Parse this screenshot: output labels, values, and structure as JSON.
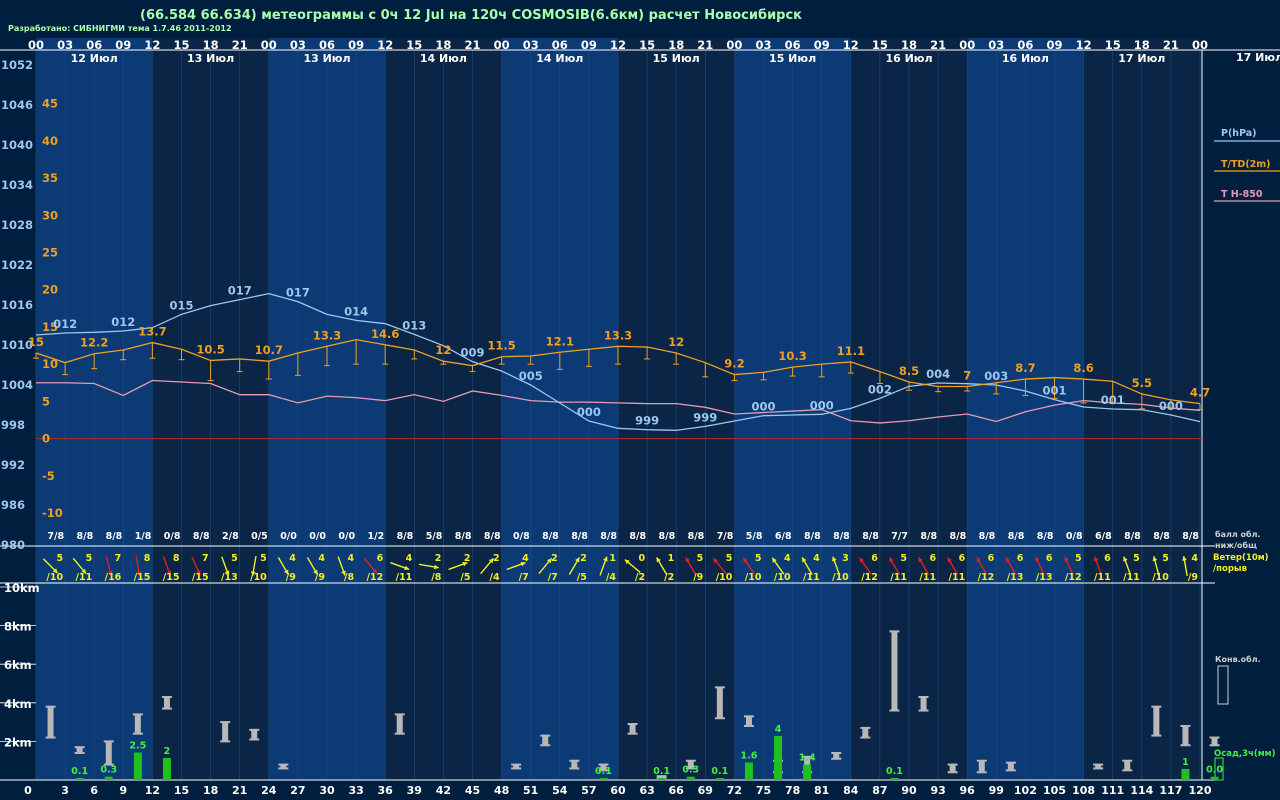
{
  "header": {
    "title": "(66.584 66.634) метеограммы с  0ч 12 Jul на 120ч COSMOSIB(6.6км) расчет Новосибирск",
    "credit": "Разработано: СИБНИГМИ тема 1.7.46 2011-2012"
  },
  "colors": {
    "background": "#001f3f",
    "band_light": "#0c3a74",
    "band_dark": "#0a2546",
    "pressure": "#9cc8f0",
    "temperature": "#f0a020",
    "t850": "#e89ab4",
    "zero_line": "#a03030",
    "wind_yellow": "#f0f020",
    "wind_red": "#e02020",
    "cloud": "#b8b8b8",
    "precip": "#20c020",
    "precip_label": "#40f040",
    "text": "#ffffff",
    "title": "#a8ffa8"
  },
  "chart_data": {
    "type": "line",
    "x_hours": [
      0,
      3,
      6,
      9,
      12,
      15,
      18,
      21,
      24,
      27,
      30,
      33,
      36,
      39,
      42,
      45,
      48,
      51,
      54,
      57,
      60,
      63,
      66,
      69,
      72,
      75,
      78,
      81,
      84,
      87,
      90,
      93,
      96,
      99,
      102,
      105,
      108,
      111,
      114,
      117,
      120
    ],
    "top_hour_labels": [
      "00",
      "03",
      "06",
      "09",
      "12",
      "15",
      "18",
      "21",
      "00",
      "03",
      "06",
      "09",
      "12",
      "15",
      "18",
      "21",
      "00",
      "03",
      "06",
      "09",
      "12",
      "15",
      "18",
      "21",
      "00",
      "03",
      "06",
      "09",
      "12",
      "15",
      "18",
      "21",
      "00",
      "03",
      "06",
      "09",
      "12",
      "15",
      "18",
      "21",
      "00"
    ],
    "date_labels": [
      "12 Июл",
      "13 Июл",
      "13 Июл",
      "14 Июл",
      "14 Июл",
      "15 Июл",
      "15 Июл",
      "16 Июл",
      "16 Июл",
      "17 Июл"
    ],
    "right_date_label": "17 Июл",
    "bottom_hour_labels": [
      "0",
      "3",
      "6",
      "9",
      "12",
      "15",
      "18",
      "21",
      "24",
      "27",
      "30",
      "33",
      "36",
      "39",
      "42",
      "45",
      "48",
      "51",
      "54",
      "57",
      "60",
      "63",
      "66",
      "69",
      "72",
      "75",
      "78",
      "81",
      "84",
      "87",
      "90",
      "93",
      "96",
      "99",
      "102",
      "105",
      "108",
      "111",
      "114",
      "117",
      "120"
    ],
    "pressure_axis": {
      "ticks": [
        "1052",
        "1046",
        "1040",
        "1034",
        "1028",
        "1022",
        "1016",
        "1010",
        "1004",
        "998",
        "992",
        "986",
        "980"
      ],
      "ylim": [
        980,
        1052
      ]
    },
    "temperature_axis": {
      "ticks": [
        "45",
        "40",
        "35",
        "30",
        "25",
        "20",
        "15",
        "10",
        "5",
        "0",
        "-5",
        "-10"
      ],
      "ylim": [
        -14.3,
        50.2
      ]
    },
    "legend": {
      "pressure": "P(hPa)",
      "temperature": "T/TD(2m)",
      "t850": "T H-850",
      "clouds": "балл обл.\nниж/общ",
      "wind": "Ветер(10м)\n/порыв",
      "convective": "Конв.обл.",
      "precip": "Осад,3ч(мм)"
    },
    "series": [
      {
        "name": "P(hPa)",
        "values": [
          1011.5,
          1011.8,
          1011.9,
          1012.1,
          1012.6,
          1014.6,
          1015.9,
          1016.8,
          1017.7,
          1016.5,
          1014.6,
          1013.7,
          1013.2,
          1011.6,
          1009.9,
          1007.5,
          1006.1,
          1004.0,
          1001.3,
          998.6,
          997.5,
          997.3,
          997.2,
          997.8,
          998.6,
          999.4,
          999.5,
          999.6,
          1000.5,
          1002.0,
          1003.8,
          1004.3,
          1004.2,
          1004.0,
          1003.1,
          1001.8,
          1000.7,
          1000.4,
          1000.3,
          999.5,
          998.5
        ]
      },
      {
        "name": "T/TD(2m)",
        "values": [
          11.5,
          10.2,
          11.4,
          11.9,
          12.9,
          12.0,
          10.5,
          10.7,
          10.4,
          11.5,
          12.4,
          13.3,
          12.6,
          11.9,
          10.4,
          9.8,
          11.0,
          11.1,
          11.6,
          12.0,
          12.4,
          12.3,
          11.5,
          10.2,
          8.6,
          8.9,
          9.6,
          10.0,
          10.3,
          9.0,
          7.6,
          7.0,
          7.0,
          7.5,
          8.0,
          8.2,
          8.0,
          7.7,
          6.0,
          5.2,
          4.7
        ]
      },
      {
        "name": "TD(2m)",
        "values": [
          10.8,
          8.6,
          9.4,
          10.6,
          10.8,
          10.6,
          7.8,
          9.0,
          8.0,
          8.5,
          9.8,
          10.0,
          10.0,
          10.7,
          10.0,
          9.0,
          10.0,
          10.0,
          9.3,
          9.7,
          10.0,
          10.7,
          10.0,
          8.3,
          7.8,
          7.9,
          8.4,
          8.3,
          8.8,
          7.4,
          6.5,
          6.3,
          6.4,
          6.0,
          5.8,
          5.4,
          4.8,
          4.7,
          4.0,
          4.0,
          3.9
        ]
      },
      {
        "name": "T H-850",
        "values": [
          7.5,
          7.5,
          7.4,
          5.8,
          7.8,
          7.6,
          7.4,
          5.9,
          5.9,
          4.8,
          5.7,
          5.5,
          5.1,
          5.9,
          5.0,
          6.4,
          5.8,
          5.1,
          4.9,
          4.9,
          4.8,
          4.7,
          4.7,
          4.2,
          3.3,
          3.5,
          3.7,
          3.9,
          2.4,
          2.1,
          2.4,
          2.9,
          3.3,
          2.3,
          3.6,
          4.5,
          5.1,
          4.8,
          4.6,
          4.1,
          3.8
        ]
      }
    ],
    "pressure_labels": [
      {
        "x": 3,
        "text": "012"
      },
      {
        "x": 9,
        "text": "012"
      },
      {
        "x": 15,
        "text": "015"
      },
      {
        "x": 21,
        "text": "017"
      },
      {
        "x": 27,
        "text": "017"
      },
      {
        "x": 33,
        "text": "014"
      },
      {
        "x": 39,
        "text": "013"
      },
      {
        "x": 45,
        "text": "009"
      },
      {
        "x": 51,
        "text": "005"
      },
      {
        "x": 57,
        "text": "000"
      },
      {
        "x": 63,
        "text": "999"
      },
      {
        "x": 69,
        "text": "999"
      },
      {
        "x": 75,
        "text": "000"
      },
      {
        "x": 81,
        "text": "000"
      },
      {
        "x": 87,
        "text": "002"
      },
      {
        "x": 93,
        "text": "004"
      },
      {
        "x": 99,
        "text": "003"
      },
      {
        "x": 105,
        "text": "001"
      },
      {
        "x": 111,
        "text": "001"
      },
      {
        "x": 117,
        "text": "000"
      }
    ],
    "temperature_labels": [
      {
        "x": 0,
        "text": "15"
      },
      {
        "x": 6,
        "text": "12.2"
      },
      {
        "x": 12,
        "text": "13.7"
      },
      {
        "x": 18,
        "text": "10.5"
      },
      {
        "x": 24,
        "text": "10.7"
      },
      {
        "x": 30,
        "text": "13.3"
      },
      {
        "x": 36,
        "text": "14.6"
      },
      {
        "x": 42,
        "text": "12"
      },
      {
        "x": 48,
        "text": "11.5"
      },
      {
        "x": 54,
        "text": "12.1"
      },
      {
        "x": 60,
        "text": "13.3"
      },
      {
        "x": 66,
        "text": "12"
      },
      {
        "x": 72,
        "text": "9.2"
      },
      {
        "x": 78,
        "text": "10.3"
      },
      {
        "x": 84,
        "text": "11.1"
      },
      {
        "x": 90,
        "text": "8.5"
      },
      {
        "x": 96,
        "text": "7"
      },
      {
        "x": 102,
        "text": "8.7"
      },
      {
        "x": 108,
        "text": "8.6"
      },
      {
        "x": 114,
        "text": "5.5"
      },
      {
        "x": 120,
        "text": "4.7"
      }
    ],
    "cloud_cover": [
      "7/8",
      "8/8",
      "8/8",
      "1/8",
      "0/8",
      "8/8",
      "2/8",
      "0/5",
      "0/0",
      "0/0",
      "0/0",
      "1/2",
      "8/8",
      "5/8",
      "8/8",
      "8/8",
      "0/8",
      "8/8",
      "8/8",
      "8/8",
      "8/8",
      "8/8",
      "8/8",
      "7/8",
      "5/8",
      "6/8",
      "8/8",
      "8/8",
      "8/8",
      "7/7",
      "8/8",
      "8/8",
      "8/8",
      "8/8",
      "8/8",
      "0/8",
      "6/8",
      "8/8",
      "8/8",
      "8/8"
    ],
    "wind": [
      {
        "speed": "5",
        "gust": "/10",
        "color": "yellow",
        "angle": 45
      },
      {
        "speed": "5",
        "gust": "/11",
        "color": "yellow",
        "angle": 40
      },
      {
        "speed": "7",
        "gust": "/16",
        "color": "red",
        "angle": 15
      },
      {
        "speed": "8",
        "gust": "/15",
        "color": "red",
        "angle": 10
      },
      {
        "speed": "8",
        "gust": "/15",
        "color": "red",
        "angle": 20
      },
      {
        "speed": "7",
        "gust": "/15",
        "color": "red",
        "angle": 25
      },
      {
        "speed": "5",
        "gust": "/13",
        "color": "yellow",
        "angle": 20
      },
      {
        "speed": "5",
        "gust": "/10",
        "color": "yellow",
        "angle": -10
      },
      {
        "speed": "4",
        "gust": "/9",
        "color": "yellow",
        "angle": 30
      },
      {
        "speed": "4",
        "gust": "/9",
        "color": "yellow",
        "angle": 30
      },
      {
        "speed": "4",
        "gust": "/8",
        "color": "yellow",
        "angle": 20
      },
      {
        "speed": "6",
        "gust": "/12",
        "color": "red",
        "angle": 40
      },
      {
        "speed": "4",
        "gust": "/11",
        "color": "yellow",
        "angle": 70
      },
      {
        "speed": "2",
        "gust": "/8",
        "color": "yellow",
        "angle": 80
      },
      {
        "speed": "2",
        "gust": "/5",
        "color": "yellow",
        "angle": 110
      },
      {
        "speed": "2",
        "gust": "/4",
        "color": "yellow",
        "angle": 140
      },
      {
        "speed": "4",
        "gust": "/7",
        "color": "yellow",
        "angle": 110
      },
      {
        "speed": "2",
        "gust": "/7",
        "color": "yellow",
        "angle": 140
      },
      {
        "speed": "2",
        "gust": "/5",
        "color": "yellow",
        "angle": 150
      },
      {
        "speed": "1",
        "gust": "/4",
        "color": "yellow",
        "angle": 160
      },
      {
        "speed": "0",
        "gust": "/2",
        "color": "yellow",
        "angle": 230
      },
      {
        "speed": "1",
        "gust": "/2",
        "color": "yellow",
        "angle": 210
      },
      {
        "speed": "5",
        "gust": "/9",
        "color": "red",
        "angle": 210
      },
      {
        "speed": "5",
        "gust": "/10",
        "color": "red",
        "angle": 220
      },
      {
        "speed": "5",
        "gust": "/10",
        "color": "red",
        "angle": 215
      },
      {
        "speed": "4",
        "gust": "/10",
        "color": "yellow",
        "angle": 215
      },
      {
        "speed": "4",
        "gust": "/11",
        "color": "yellow",
        "angle": 210
      },
      {
        "speed": "3",
        "gust": "/10",
        "color": "yellow",
        "angle": 200
      },
      {
        "speed": "6",
        "gust": "/12",
        "color": "red",
        "angle": 215
      },
      {
        "speed": "5",
        "gust": "/11",
        "color": "red",
        "angle": 210
      },
      {
        "speed": "6",
        "gust": "/11",
        "color": "red",
        "angle": 210
      },
      {
        "speed": "6",
        "gust": "/11",
        "color": "red",
        "angle": 210
      },
      {
        "speed": "6",
        "gust": "/12",
        "color": "red",
        "angle": 210
      },
      {
        "speed": "6",
        "gust": "/13",
        "color": "red",
        "angle": 210
      },
      {
        "speed": "6",
        "gust": "/13",
        "color": "red",
        "angle": 205
      },
      {
        "speed": "5",
        "gust": "/12",
        "color": "red",
        "angle": 205
      },
      {
        "speed": "6",
        "gust": "/11",
        "color": "red",
        "angle": 200
      },
      {
        "speed": "5",
        "gust": "/11",
        "color": "yellow",
        "angle": 200
      },
      {
        "speed": "5",
        "gust": "/10",
        "color": "yellow",
        "angle": 195
      },
      {
        "speed": "4",
        "gust": "/9",
        "color": "yellow",
        "angle": 190
      }
    ],
    "height_axis": {
      "ticks": [
        "10km",
        "8km",
        "6km",
        "4km",
        "2km"
      ],
      "ylim": [
        0,
        11
      ]
    },
    "convective_clouds": [
      {
        "x": 1.5,
        "base": 2.2,
        "top": 3.8
      },
      {
        "x": 4.5,
        "base": 1.4,
        "top": 1.7
      },
      {
        "x": 7.5,
        "base": 0.8,
        "top": 2.0
      },
      {
        "x": 10.5,
        "base": 2.4,
        "top": 3.4
      },
      {
        "x": 13.5,
        "base": 3.7,
        "top": 4.3
      },
      {
        "x": 19.5,
        "base": 2.0,
        "top": 3.0
      },
      {
        "x": 22.5,
        "base": 2.1,
        "top": 2.6
      },
      {
        "x": 25.5,
        "base": 0.6,
        "top": 0.8
      },
      {
        "x": 37.5,
        "base": 2.4,
        "top": 3.4
      },
      {
        "x": 49.5,
        "base": 0.6,
        "top": 0.8
      },
      {
        "x": 52.5,
        "base": 1.8,
        "top": 2.3
      },
      {
        "x": 55.5,
        "base": 0.6,
        "top": 1.0
      },
      {
        "x": 58.5,
        "base": 0.5,
        "top": 0.8
      },
      {
        "x": 61.5,
        "base": 2.4,
        "top": 2.9
      },
      {
        "x": 64.5,
        "base": 0.1,
        "top": 0.2
      },
      {
        "x": 67.5,
        "base": 0.6,
        "top": 1.0
      },
      {
        "x": 70.5,
        "base": 3.2,
        "top": 4.8
      },
      {
        "x": 73.5,
        "base": 2.8,
        "top": 3.3
      },
      {
        "x": 76.5,
        "base": 0.4,
        "top": 1.0
      },
      {
        "x": 79.5,
        "base": 0.4,
        "top": 1.2
      },
      {
        "x": 82.5,
        "base": 1.1,
        "top": 1.4
      },
      {
        "x": 85.5,
        "base": 2.2,
        "top": 2.7
      },
      {
        "x": 88.5,
        "base": 3.6,
        "top": 7.7
      },
      {
        "x": 91.5,
        "base": 3.6,
        "top": 4.3
      },
      {
        "x": 94.5,
        "base": 0.4,
        "top": 0.8
      },
      {
        "x": 97.5,
        "base": 0.4,
        "top": 1.0
      },
      {
        "x": 100.5,
        "base": 0.5,
        "top": 0.9
      },
      {
        "x": 109.5,
        "base": 0.6,
        "top": 0.8
      },
      {
        "x": 112.5,
        "base": 0.5,
        "top": 1.0
      },
      {
        "x": 115.5,
        "base": 2.3,
        "top": 3.8
      },
      {
        "x": 118.5,
        "base": 1.8,
        "top": 2.8
      },
      {
        "x": 121.5,
        "base": 1.8,
        "top": 2.2
      }
    ],
    "precipitation": [
      {
        "x": 6,
        "value": 0.1,
        "label": "0.1"
      },
      {
        "x": 9,
        "value": 0.3,
        "label": "0.3"
      },
      {
        "x": 12,
        "value": 2.5,
        "label": "2.5"
      },
      {
        "x": 15,
        "value": 2,
        "label": "2"
      },
      {
        "x": 60,
        "value": 0.1,
        "label": "0.1"
      },
      {
        "x": 66,
        "value": 0.1,
        "label": "0.1"
      },
      {
        "x": 69,
        "value": 0.3,
        "label": "0.3"
      },
      {
        "x": 72,
        "value": 0.1,
        "label": "0.1"
      },
      {
        "x": 75,
        "value": 1.6,
        "label": "1.6"
      },
      {
        "x": 78,
        "value": 4,
        "label": "4"
      },
      {
        "x": 81,
        "value": 1.4,
        "label": "1.4"
      },
      {
        "x": 90,
        "value": 0.1,
        "label": "0.1"
      },
      {
        "x": 120,
        "value": 1,
        "label": "1"
      },
      {
        "x": 123,
        "value": 0.3,
        "label": "0.0"
      }
    ]
  }
}
